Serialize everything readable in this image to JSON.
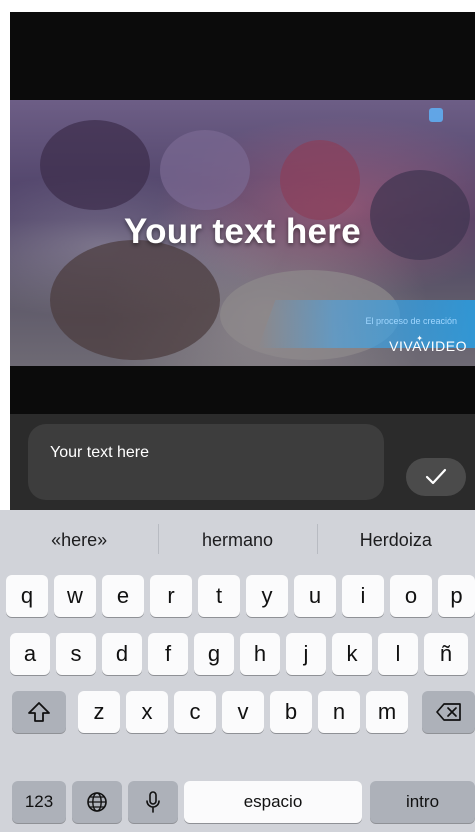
{
  "video": {
    "overlay_text": "Your text here",
    "banner_text": "El proceso de creación",
    "brand": "VIVAVIDEO"
  },
  "editor": {
    "text_value": "Your text here",
    "confirm_icon": "check-icon"
  },
  "keyboard": {
    "suggestions": [
      "«here»",
      "hermano",
      "Herdoiza"
    ],
    "row1": [
      "q",
      "w",
      "e",
      "r",
      "t",
      "y",
      "u",
      "i",
      "o",
      "p"
    ],
    "row2": [
      "a",
      "s",
      "d",
      "f",
      "g",
      "h",
      "j",
      "k",
      "l",
      "ñ"
    ],
    "row3": [
      "z",
      "x",
      "c",
      "v",
      "b",
      "n",
      "m"
    ],
    "numbers_label": "123",
    "space_label": "espacio",
    "return_label": "intro",
    "icons": [
      "shift-icon",
      "delete-icon",
      "globe-icon",
      "microphone-icon"
    ]
  }
}
